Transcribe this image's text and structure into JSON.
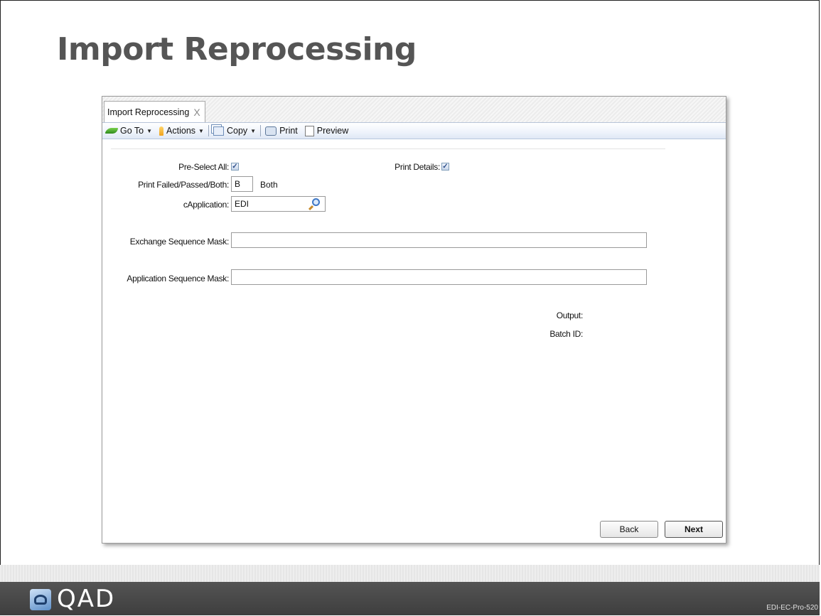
{
  "slide": {
    "title": "Import Reprocessing",
    "code": "EDI-EC-Pro-520",
    "logo_text": "QAD"
  },
  "window": {
    "tab_label": "Import Reprocessing",
    "tab_close": "X",
    "toolbar": {
      "goto_label": "Go To",
      "actions_label": "Actions",
      "copy_label": "Copy",
      "print_label": "Print",
      "preview_label": "Preview"
    },
    "form": {
      "preselect_all_label": "Pre-Select All:",
      "preselect_all_checked": true,
      "print_details_label": "Print Details:",
      "print_details_checked": true,
      "print_failed_label": "Print Failed/Passed/Both:",
      "print_failed_value": "B",
      "print_failed_desc": "Both",
      "capplication_label": "cApplication:",
      "capplication_value": "EDI",
      "exchange_mask_label": "Exchange Sequence Mask:",
      "exchange_mask_value": "",
      "application_mask_label": "Application Sequence Mask:",
      "application_mask_value": "",
      "output_label": "Output:",
      "batch_id_label": "Batch ID:"
    },
    "buttons": {
      "back_label": "Back",
      "next_label": "Next"
    }
  },
  "icons": [
    "go-to-icon",
    "actions-icon",
    "copy-icon",
    "print-icon",
    "preview-icon",
    "lookup-search-icon",
    "checkbox-check-icon",
    "qad-logo-icon"
  ]
}
